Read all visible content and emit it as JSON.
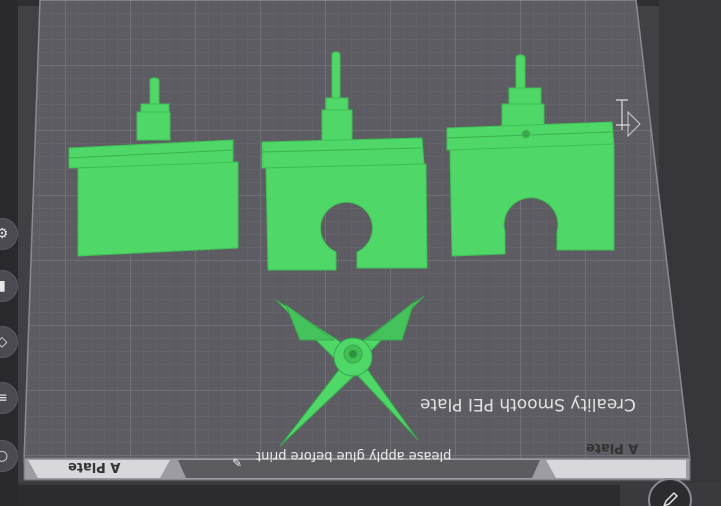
{
  "plate": {
    "brand_text": "Creality Smooth PEI Plate",
    "glue_text": "please apply glue before print",
    "tab_left": "A Plate",
    "tab_right": "A Plate"
  },
  "toolbar": {
    "left_icons": [
      "gear-icon",
      "marker-icon",
      "shape-icon",
      "layers-icon",
      "circle-icon"
    ],
    "edit_icon": "pencil-icon"
  },
  "colors": {
    "model": "#4fd768",
    "plate": "#5b5b60",
    "grid": "#727279",
    "background": "#3d3d42"
  }
}
